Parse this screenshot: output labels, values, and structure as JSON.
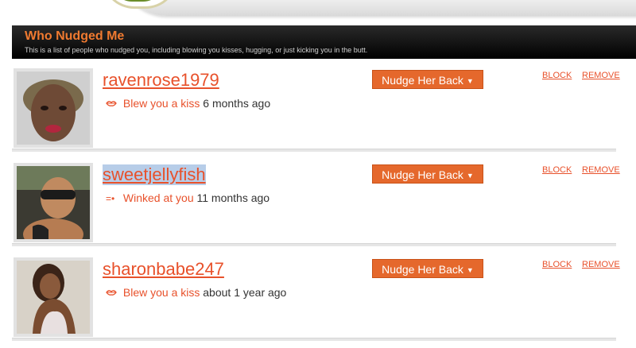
{
  "header": {
    "title": "Who Nudged Me",
    "subtitle": "This is a list of people who nudged you, including blowing you kisses, hugging, or just kicking you in the butt."
  },
  "actions": {
    "nudge_back": "Nudge Her Back",
    "block": "BLOCK",
    "remove": "REMOVE"
  },
  "nudges": [
    {
      "username": "ravenrose1979",
      "icon": "kiss-lips-icon",
      "action_text": "Blew you a kiss",
      "time": "6 months ago"
    },
    {
      "username": "sweetjellyfish",
      "icon": "wink-icon",
      "action_text": "Winked at you",
      "time": "11 months ago"
    },
    {
      "username": "sharonbabe247",
      "icon": "kiss-lips-icon",
      "action_text": "Blew you a kiss",
      "time": "about 1 year ago"
    }
  ],
  "colors": {
    "accent": "#e8512b",
    "button": "#e5682c",
    "header_bg": "#111111",
    "header_title": "#f07a30",
    "selection": "#b7cde8"
  }
}
